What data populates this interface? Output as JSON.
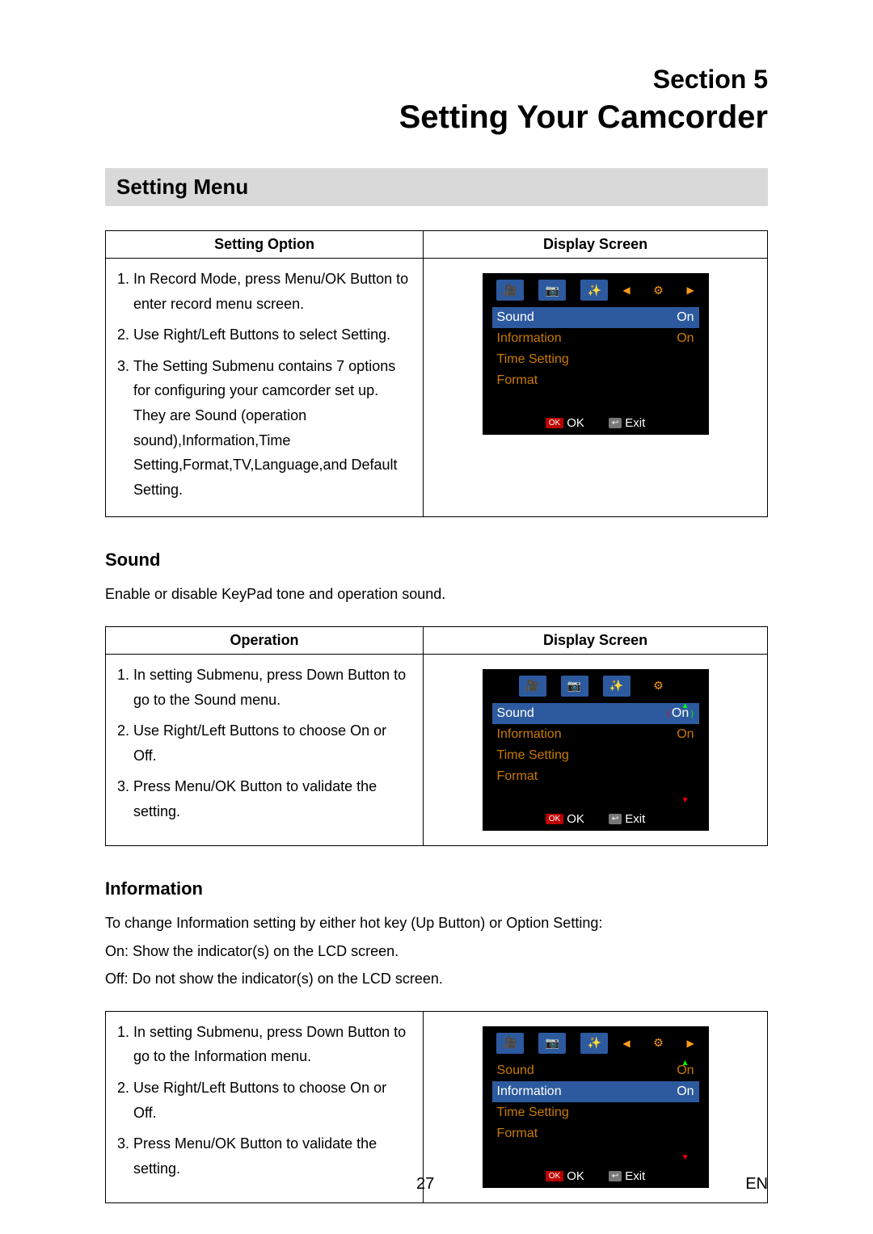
{
  "section_num": "Section 5",
  "section_title": "Setting Your Camcorder",
  "menu_heading": "Setting Menu",
  "headers": {
    "setting_option": "Setting Option",
    "display_screen": "Display Screen",
    "operation": "Operation"
  },
  "table1_steps": [
    "In Record Mode, press Menu/OK Button to enter record menu screen.",
    "Use Right/Left Buttons to select Setting.",
    "The Setting Submenu contains 7 options for configuring your camcorder set up. They are Sound (operation sound),Information,Time Setting,Format,TV,Language,and Default Setting."
  ],
  "sound": {
    "heading": "Sound",
    "desc": "Enable or disable KeyPad tone and operation sound.",
    "steps": [
      "In setting Submenu, press Down Button to go to the Sound menu.",
      "Use Right/Left Buttons to choose On or Off.",
      "Press Menu/OK Button to validate the setting."
    ]
  },
  "information": {
    "heading": "Information",
    "desc": [
      "To change Information setting by either hot key (Up Button) or Option Setting:",
      "On: Show the indicator(s) on the LCD screen.",
      "Off: Do not show the indicator(s) on the LCD screen."
    ],
    "steps": [
      "In setting Submenu, press Down Button to go to the Information menu.",
      "Use Right/Left Buttons to choose On or Off.",
      "Press Menu/OK Button to validate the setting."
    ]
  },
  "screen": {
    "rows": [
      {
        "label": "Sound",
        "value": "On"
      },
      {
        "label": "Information",
        "value": "On"
      },
      {
        "label": "Time Setting",
        "value": ""
      },
      {
        "label": "Format",
        "value": ""
      }
    ],
    "ok": "OK",
    "exit": "Exit"
  },
  "footer": {
    "page": "27",
    "lang": "EN"
  }
}
